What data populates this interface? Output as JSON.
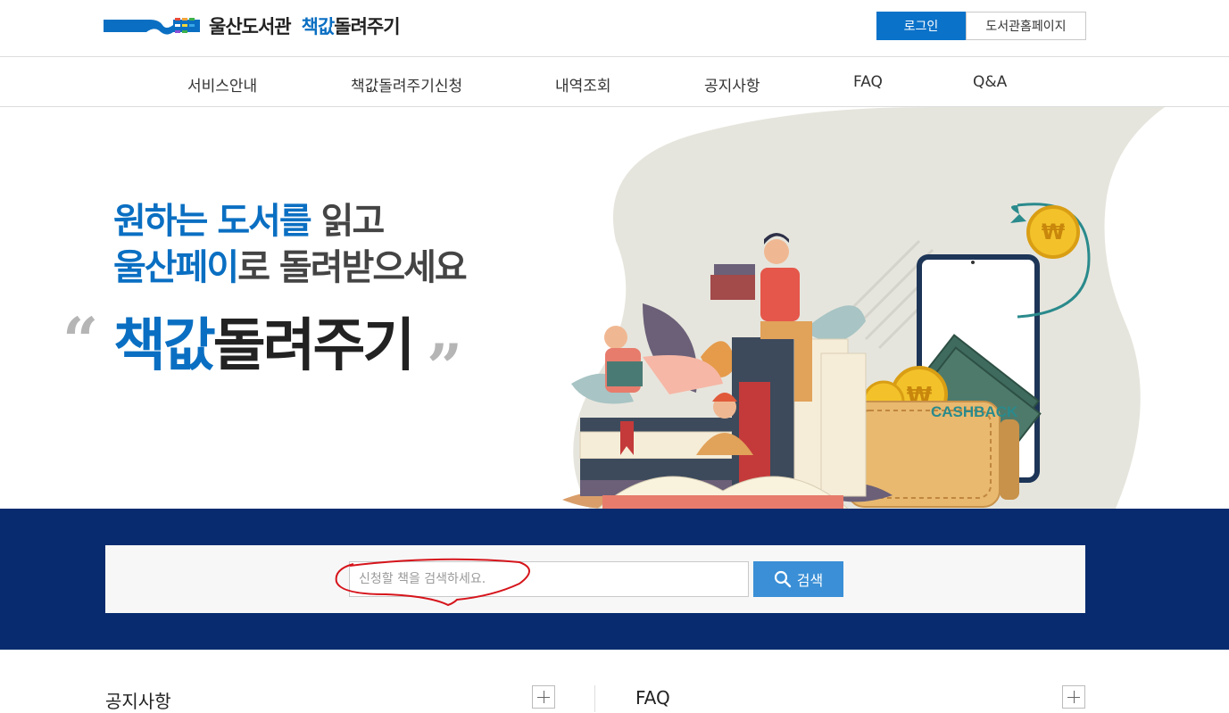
{
  "header": {
    "logo_primary": "울산도서관",
    "logo_accent": "책값",
    "logo_rest": "돌려주기",
    "login_label": "로그인",
    "library_home_label": "도서관홈페이지"
  },
  "nav": {
    "items": [
      {
        "label": "서비스안내"
      },
      {
        "label": "책값돌려주기신청"
      },
      {
        "label": "내역조회"
      },
      {
        "label": "공지사항"
      },
      {
        "label": "FAQ"
      },
      {
        "label": "Q&A"
      }
    ]
  },
  "hero": {
    "line1_a": "원하는 도서를",
    "line1_b": " 읽고",
    "line2_a": "울산페이",
    "line2_b": "로 돌려받으세요",
    "title_a": "책값",
    "title_b": "돌려주기",
    "quote_open": "“",
    "quote_close": "”",
    "cashback_label": "CASHBACK"
  },
  "search": {
    "placeholder": "신청할 책을 검색하세요.",
    "value": "",
    "button_label": "검색"
  },
  "sections": {
    "notice_title": "공지사항",
    "faq_title": "FAQ"
  },
  "colors": {
    "brand_blue": "#0a6fc2",
    "navy_band": "#072b6e",
    "search_button": "#3a8fd6",
    "annotation_red": "#d6141b"
  }
}
